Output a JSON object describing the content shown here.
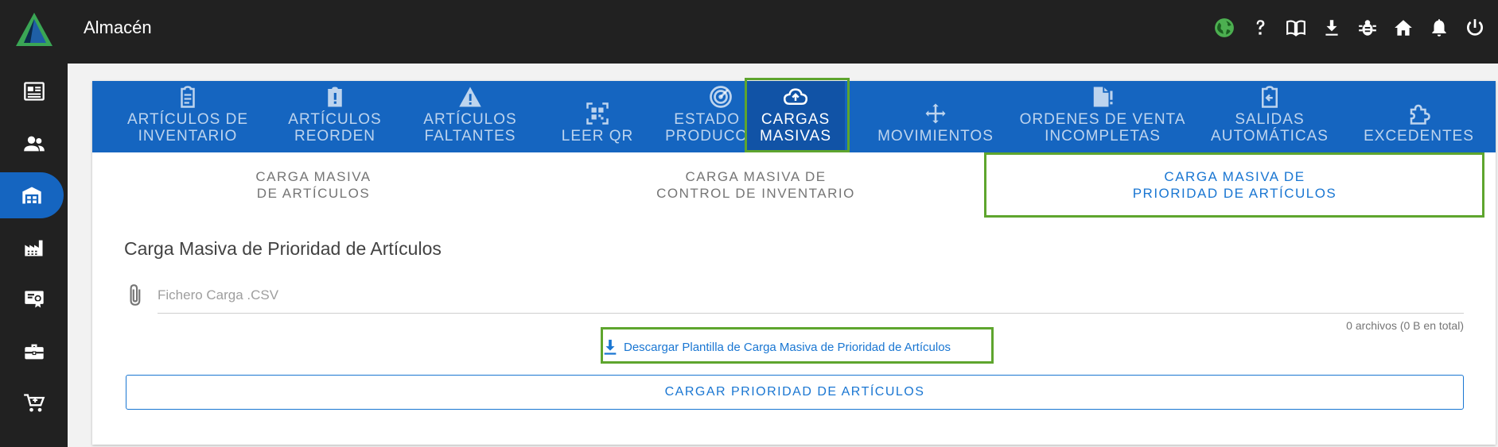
{
  "app": {
    "title": "Almacén"
  },
  "topbar_icons": [
    "globe-icon",
    "help-icon",
    "book-icon",
    "download-icon",
    "bug-icon",
    "home-icon",
    "bell-icon",
    "power-icon"
  ],
  "sidebar": {
    "items": [
      "news-icon",
      "people-icon",
      "warehouse-icon",
      "factory-icon",
      "certificate-icon",
      "briefcase-icon",
      "cart-icon"
    ],
    "active_index": 2
  },
  "tabs": [
    {
      "label": "ARTÍCULOS DE\nINVENTARIO",
      "icon": "clipboard-icon"
    },
    {
      "label": "ARTÍCULOS\nREORDEN",
      "icon": "clipboard-alert-icon"
    },
    {
      "label": "ARTÍCULOS\nFALTANTES",
      "icon": "warning-icon"
    },
    {
      "label": "LEER QR",
      "icon": "qr-scan-icon"
    },
    {
      "label": "ESTADO DE\nPRODUCCIÓN",
      "icon": "radar-icon"
    },
    {
      "label": "CARGAS\nMASIVAS",
      "icon": "cloud-upload-icon"
    },
    {
      "label": "MOVIMIENTOS",
      "icon": "move-arrows-icon"
    },
    {
      "label": "ORDENES DE VENTA\nINCOMPLETAS",
      "icon": "file-alert-icon"
    },
    {
      "label": "SALIDAS\nAUTOMÁTICAS",
      "icon": "clipboard-arrow-icon"
    },
    {
      "label": "EXCEDENTES",
      "icon": "puzzle-icon"
    }
  ],
  "active_tab": 5,
  "subtabs": [
    {
      "label": "CARGA MASIVA\nDE ARTÍCULOS"
    },
    {
      "label": "CARGA MASIVA DE\nCONTROL DE INVENTARIO"
    },
    {
      "label": "CARGA MASIVA DE\nPRIORIDAD DE ARTÍCULOS"
    }
  ],
  "active_subtab": 2,
  "section": {
    "title": "Carga Masiva de Prioridad de Artículos",
    "file_placeholder": "Fichero Carga .CSV",
    "file_counter": "0 archivos (0 B en total)",
    "download_link": "Descargar Plantilla de Carga Masiva de Prioridad de Artículos",
    "upload_button": "CARGAR PRIORIDAD DE ARTÍCULOS"
  },
  "colors": {
    "primary": "#1565c0",
    "topbar": "#212121",
    "highlight": "#5ea52e",
    "link": "#1976d2"
  }
}
